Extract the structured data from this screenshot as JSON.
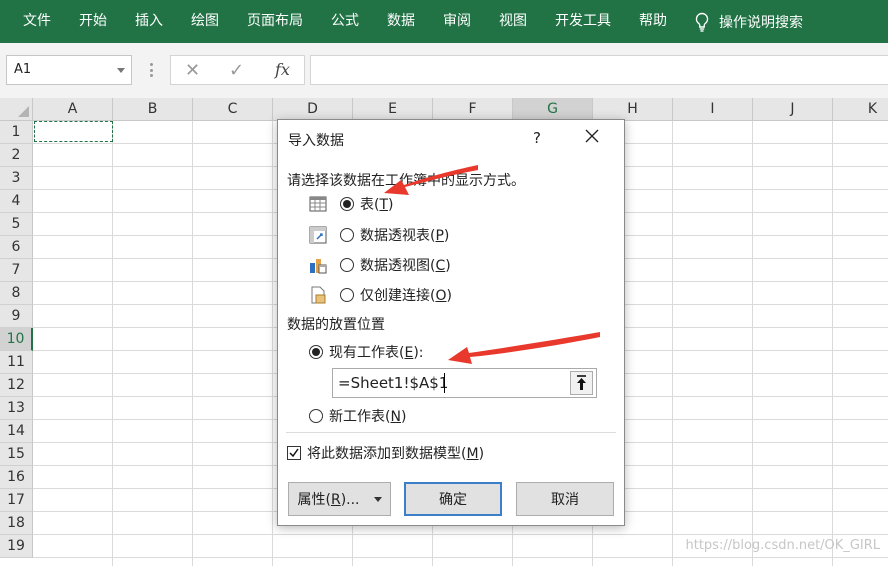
{
  "ribbon": {
    "tabs": [
      "文件",
      "开始",
      "插入",
      "绘图",
      "页面布局",
      "公式",
      "数据",
      "审阅",
      "视图",
      "开发工具",
      "帮助"
    ],
    "tell_me": "操作说明搜索",
    "icon": "lightbulb-icon"
  },
  "formula_bar": {
    "name_box": "A1",
    "cancel_icon": "close-icon",
    "enter_icon": "check-icon",
    "fx_label": "fx",
    "formula": ""
  },
  "sheet": {
    "columns": [
      "A",
      "B",
      "C",
      "D",
      "E",
      "F",
      "G",
      "H",
      "I",
      "J",
      "K"
    ],
    "rows": [
      "1",
      "2",
      "3",
      "4",
      "5",
      "6",
      "7",
      "8",
      "9",
      "10",
      "11",
      "12",
      "13",
      "14",
      "15",
      "16",
      "17",
      "18",
      "19"
    ],
    "selected_column": "G",
    "selected_row": "10",
    "active_cell": "A1"
  },
  "dialog": {
    "title": "导入数据",
    "help": "?",
    "prompt": "请选择该数据在工作簿中的显示方式。",
    "view_options": [
      {
        "pre": "表(",
        "key": "T",
        "post": ")",
        "checked": true,
        "icon": "table-icon"
      },
      {
        "pre": "数据透视表(",
        "key": "P",
        "post": ")",
        "checked": false,
        "icon": "pivot-table-icon"
      },
      {
        "pre": "数据透视图(",
        "key": "C",
        "post": ")",
        "checked": false,
        "icon": "pivot-chart-icon"
      },
      {
        "pre": "仅创建连接(",
        "key": "O",
        "post": ")",
        "checked": false,
        "icon": "connection-icon"
      }
    ],
    "placement_heading": "数据的放置位置",
    "existing_sheet": {
      "pre": "现有工作表(",
      "key": "E",
      "post": "):",
      "checked": true
    },
    "reference": "=Sheet1!$A$1",
    "new_sheet": {
      "pre": "新工作表(",
      "key": "N",
      "post": ")",
      "checked": false
    },
    "data_model": {
      "pre": "将此数据添加到数据模型(",
      "key": "M",
      "post": ")",
      "checked": true
    },
    "buttons": {
      "properties": {
        "pre": "属性(",
        "key": "R",
        "post": ")..."
      },
      "ok": "确定",
      "cancel": "取消"
    }
  },
  "watermark": "https://blog.csdn.net/OK_GIRL",
  "colors": {
    "ribbon": "#217346",
    "annotation_arrow": "#e8392c",
    "default_button_border": "#3c7fc8"
  }
}
